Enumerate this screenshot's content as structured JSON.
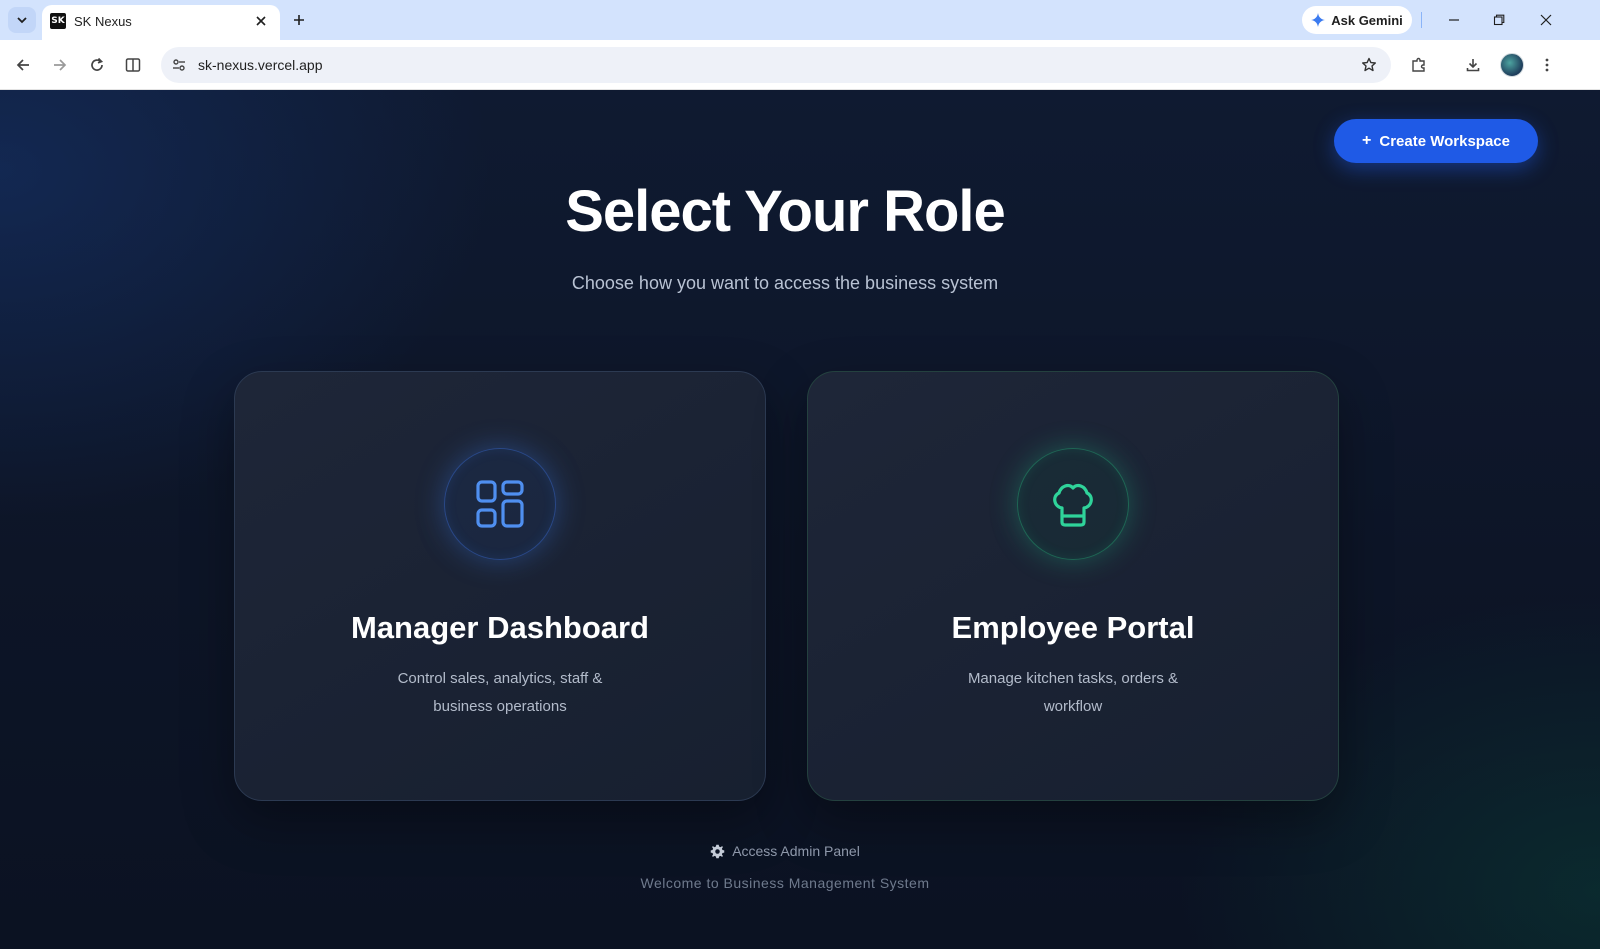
{
  "browser": {
    "tab_title": "SK Nexus",
    "favicon_text": "SK",
    "url": "sk-nexus.vercel.app",
    "gemini_label": "Ask Gemini"
  },
  "page": {
    "create_button_label": "Create Workspace",
    "create_button_icon": "+",
    "title": "Select Your Role",
    "subtitle": "Choose how you want to access the business system",
    "cards": [
      {
        "title": "Manager Dashboard",
        "description": "Control sales, analytics, staff & business operations",
        "icon": "dashboard-grid-icon",
        "accent": "#4f8ff0"
      },
      {
        "title": "Employee Portal",
        "description": "Manage kitchen tasks, orders & workflow",
        "icon": "chef-hat-icon",
        "accent": "#2fd39a"
      }
    ],
    "admin_link": "Access Admin Panel",
    "footer": "Welcome to Business Management System"
  },
  "colors": {
    "primary_button": "#1f5ae6",
    "background": "#0d1527"
  }
}
